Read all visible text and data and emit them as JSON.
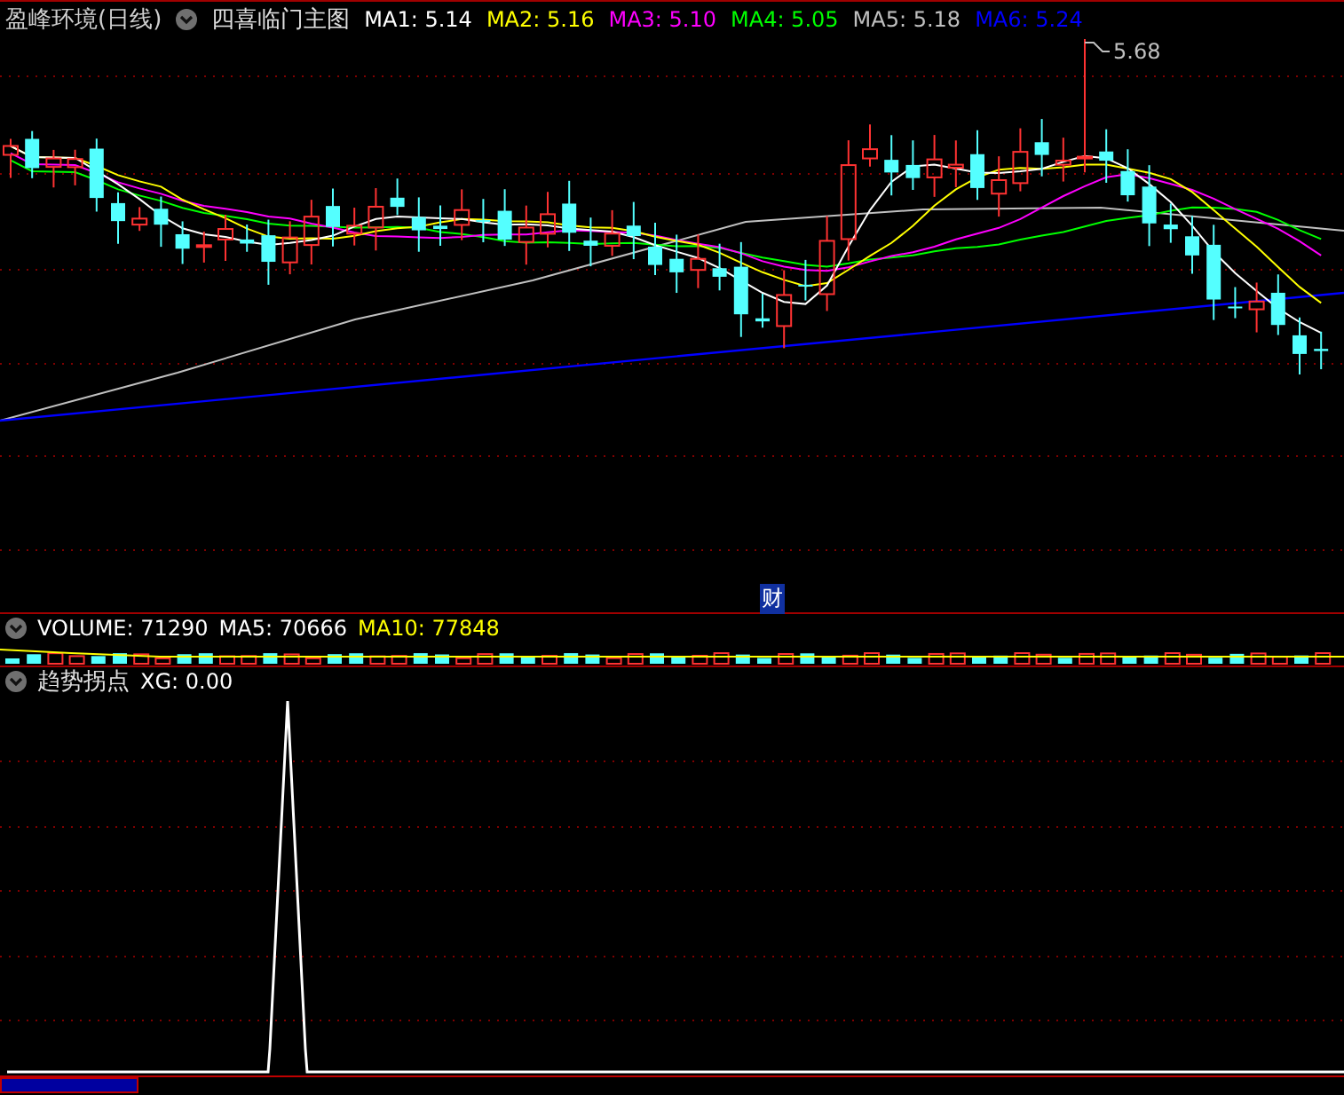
{
  "header": {
    "title": "盈峰环境(日线)",
    "indicator": "四喜临门主图",
    "readings": [
      {
        "label": "MA1: 5.14",
        "color": "#ffffff"
      },
      {
        "label": "MA2: 5.16",
        "color": "#ffff00"
      },
      {
        "label": "MA3: 5.10",
        "color": "#ff00ff"
      },
      {
        "label": "MA4: 5.05",
        "color": "#00ff00"
      },
      {
        "label": "MA5: 5.18",
        "color": "#c0c0c0"
      },
      {
        "label": "MA6: 5.24",
        "color": "#0000ff"
      }
    ]
  },
  "price_chart": {
    "max_label": "5.68",
    "marker": "财"
  },
  "volume": {
    "readings": [
      {
        "label": "VOLUME: 71290",
        "color": "#ffffff"
      },
      {
        "label": "MA5: 70666",
        "color": "#ffffff"
      },
      {
        "label": "MA10: 77848",
        "color": "#ffff00"
      }
    ]
  },
  "indicator": {
    "name": "趋势拐点",
    "readings": [
      {
        "label": "XG: 0.00",
        "color": "#ffffff"
      }
    ]
  }
}
